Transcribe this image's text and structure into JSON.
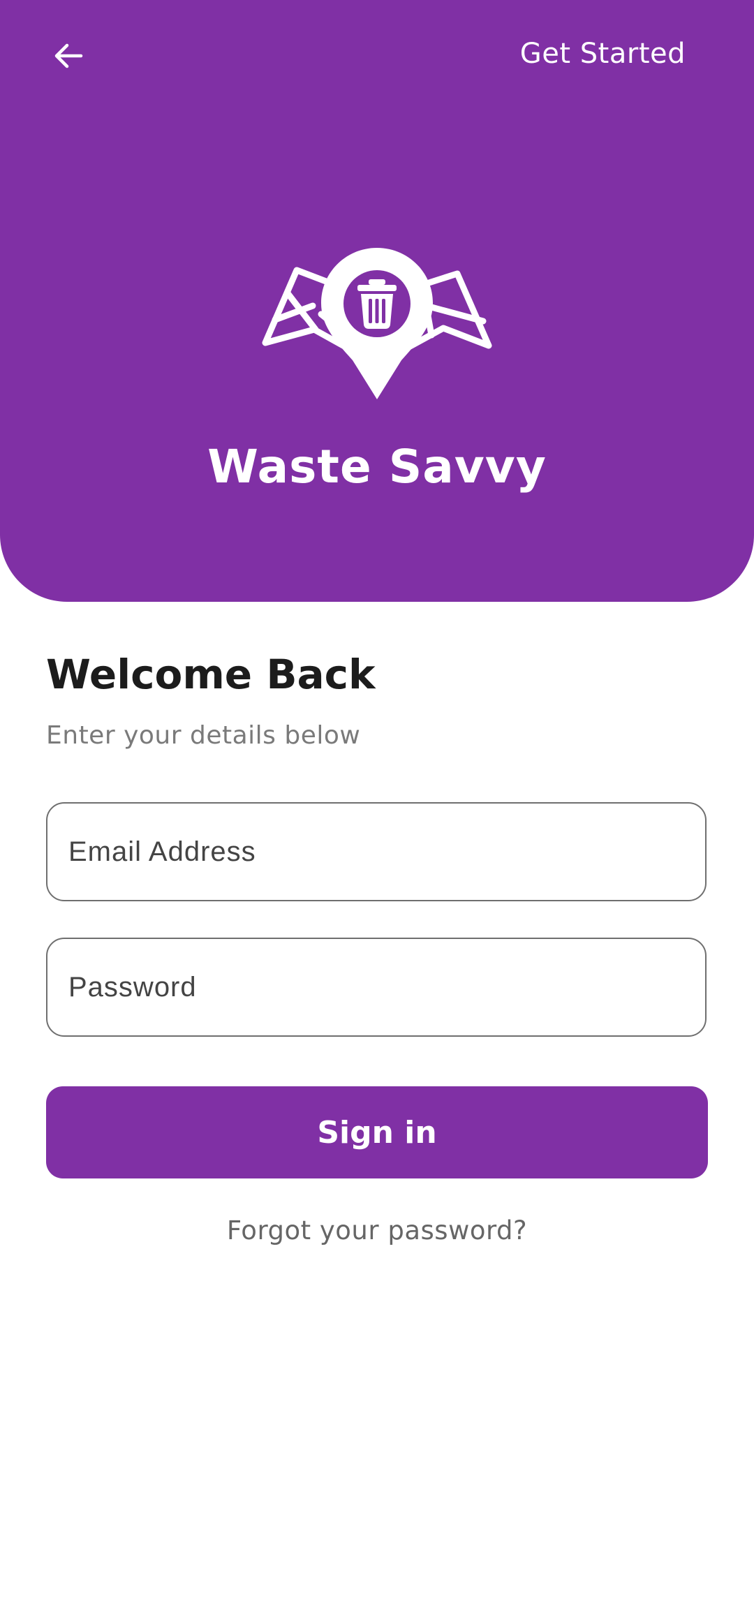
{
  "header": {
    "back_icon": "arrow-left-icon",
    "get_started_label": "Get Started"
  },
  "brand": {
    "logo_icon": "map-pin-trash-icon",
    "name": "Waste Savvy"
  },
  "form": {
    "title": "Welcome Back",
    "subtitle": "Enter your details below",
    "email_placeholder": "Email Address",
    "email_value": "",
    "password_placeholder": "Password",
    "password_value": "",
    "sign_in_label": "Sign in",
    "forgot_label": "Forgot your password?"
  },
  "colors": {
    "primary": "#8030a5",
    "background": "#ffffff",
    "title_text": "#1c1c1c",
    "muted_text": "#7a7a7a"
  }
}
